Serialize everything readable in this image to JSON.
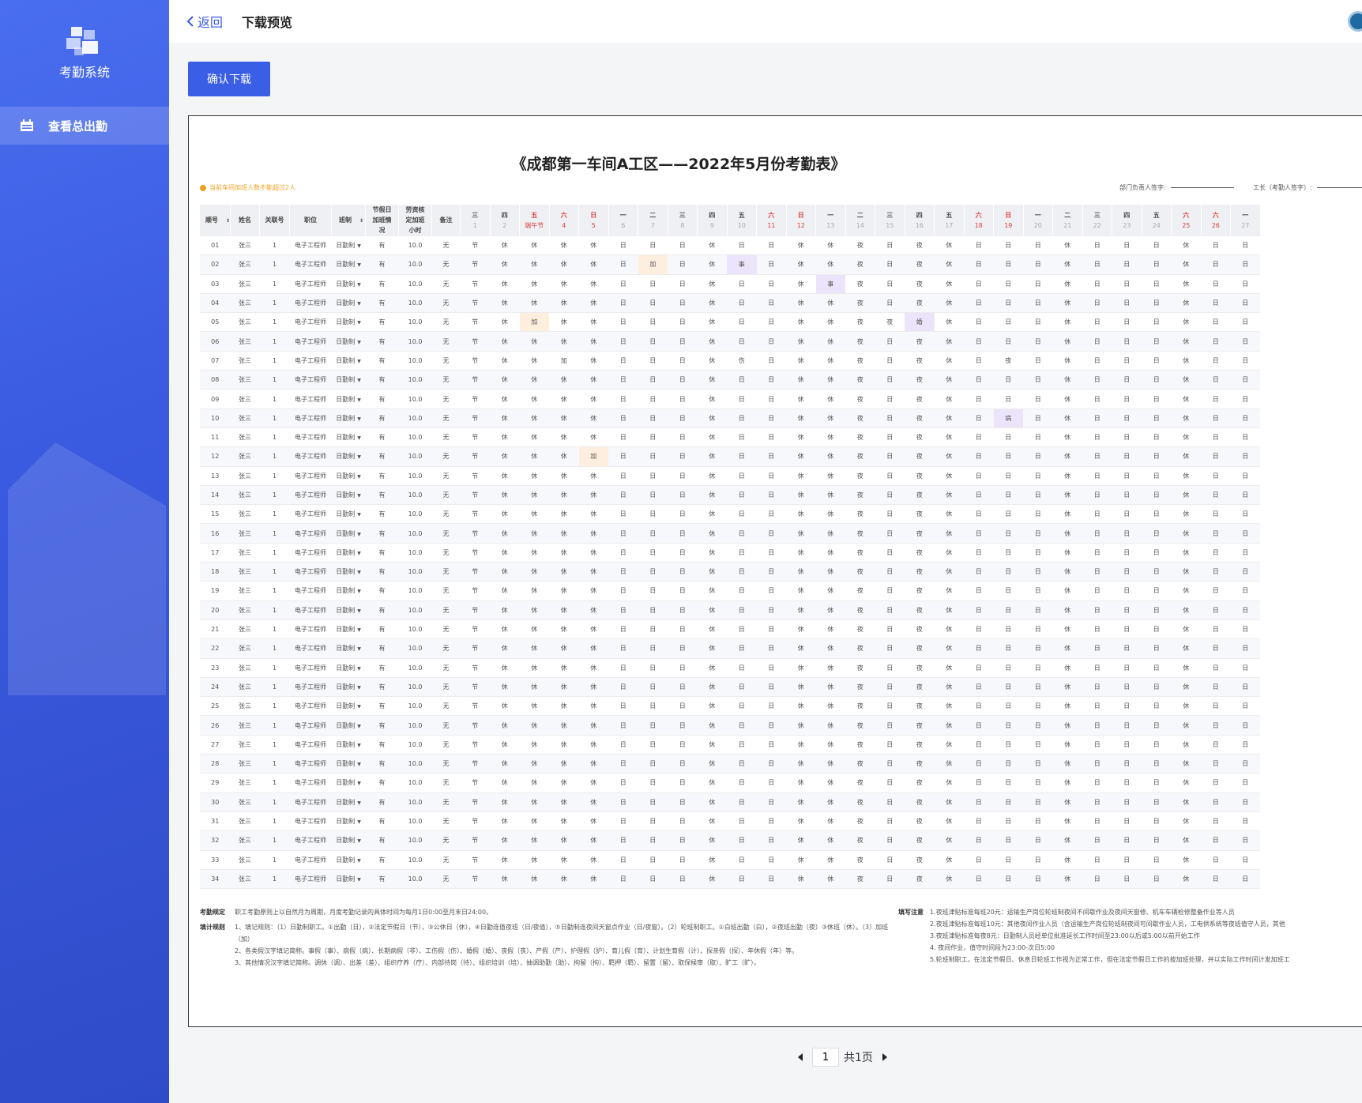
{
  "app": {
    "title": "考勤系统"
  },
  "sidebar": {
    "items": [
      {
        "label": "查看总出勤",
        "icon": "calendar-icon"
      }
    ]
  },
  "header": {
    "back_label": "返回",
    "title": "下载预览"
  },
  "toolbar": {
    "confirm_label": "确认下载"
  },
  "sheet": {
    "title": "《成都第一车间A工区——2022年5月份考勤表》",
    "notice": "当前车间加班人数不能超过2人",
    "sign_dept": "部门负责人签字:",
    "sign_leader": "工长（考勤人签字）:",
    "columns": {
      "seq": "顺号",
      "name": "姓名",
      "link": "关联号",
      "post": "职位",
      "shift": "班制",
      "holiday": "节假日加班情况",
      "ot": "劳资核定加班小时",
      "remark": "备注"
    },
    "days": [
      {
        "w": "三",
        "d": "1"
      },
      {
        "w": "四",
        "d": "2"
      },
      {
        "w": "五",
        "d": "端午节",
        "red": true
      },
      {
        "w": "六",
        "d": "4",
        "red": true
      },
      {
        "w": "日",
        "d": "5",
        "red": true
      },
      {
        "w": "一",
        "d": "6"
      },
      {
        "w": "二",
        "d": "7"
      },
      {
        "w": "三",
        "d": "8"
      },
      {
        "w": "四",
        "d": "9"
      },
      {
        "w": "五",
        "d": "10"
      },
      {
        "w": "六",
        "d": "11",
        "red": true
      },
      {
        "w": "日",
        "d": "12",
        "red": true
      },
      {
        "w": "一",
        "d": "13"
      },
      {
        "w": "二",
        "d": "14"
      },
      {
        "w": "三",
        "d": "15"
      },
      {
        "w": "四",
        "d": "16"
      },
      {
        "w": "五",
        "d": "17"
      },
      {
        "w": "六",
        "d": "18",
        "red": true
      },
      {
        "w": "日",
        "d": "19",
        "red": true
      },
      {
        "w": "一",
        "d": "20"
      },
      {
        "w": "二",
        "d": "21"
      },
      {
        "w": "三",
        "d": "22"
      },
      {
        "w": "四",
        "d": "23"
      },
      {
        "w": "五",
        "d": "24"
      },
      {
        "w": "六",
        "d": "25",
        "red": true
      },
      {
        "w": "六",
        "d": "26",
        "red": true
      },
      {
        "w": "一",
        "d": "27"
      }
    ],
    "row_template": {
      "name": "张三",
      "link": "1",
      "post": "电子工程师",
      "shift": "日勤制",
      "holiday": "有",
      "ot": "10.0",
      "remark": "无",
      "days": [
        "节",
        "休",
        "休",
        "休",
        "休",
        "日",
        "日",
        "日",
        "休",
        "日",
        "日",
        "休",
        "休",
        "夜",
        "日",
        "夜",
        "休",
        "日",
        "日",
        "日",
        "休",
        "日",
        "日",
        "日",
        "休",
        "日",
        "日"
      ]
    },
    "row_count": 34,
    "overrides": [
      {
        "row": 1,
        "col": 6,
        "v": "加",
        "hl": "or"
      },
      {
        "row": 1,
        "col": 9,
        "v": "事",
        "hl": "pu"
      },
      {
        "row": 2,
        "col": 12,
        "v": "事",
        "hl": "pu"
      },
      {
        "row": 4,
        "col": 2,
        "v": "加",
        "hl": "or"
      },
      {
        "row": 4,
        "col": 15,
        "v": "婚",
        "hl": "pu"
      },
      {
        "row": 4,
        "col": 14,
        "v": "夜"
      },
      {
        "row": 6,
        "col": 3,
        "v": "加"
      },
      {
        "row": 6,
        "col": 9,
        "v": "伤"
      },
      {
        "row": 6,
        "col": 18,
        "v": "夜"
      },
      {
        "row": 9,
        "col": 18,
        "v": "病",
        "hl": "pu"
      },
      {
        "row": 11,
        "col": 4,
        "v": "加",
        "hl": "or"
      }
    ],
    "rules_label": "考勤规定",
    "rules_text": "职工考勤原则上以自然月为周期，月度考勤记录的具体时间为每月1日0:00至月末日24:00。",
    "fill_label": "填计规则",
    "fill_lines": [
      "1、填记规则：（1）日勤制职工。①出勤（日），②法定节假日（节），③公休日（休），④日勤连值夜班（日/夜值），⑤日勤制连夜间天窗点作业（日/夜窗）。（2）轮班制职工。①白班出勤（白），②夜班出勤（夜）③休班（休）。（3）加班（加）",
      "2、各类假汉字填记简称。事假（事）、病假（病）、长期病假（非）、工伤假（伤）、婚假（婚）、丧假（丧）、产假（产）、护理假（护）、育儿假（育）、计划生育假（计）、探亲假（探）、年休假（年）等。",
      "3、其他情况汉字填记简称。调休（调）、出差（差）、组织疗养（疗）、内部待岗（待）、组织培训（培）、抽调助勤（助）、拘留（拘）、羁押（羁）、留置（留）、取保候审（取）、旷工（旷）。"
    ],
    "notes_label": "填写注意",
    "notes_lines": [
      "1.夜班津贴标准每班20元：运输生产岗位轮班制夜间不间歇作业及夜间天窗修、机车车辆检修整备作业等人员",
      "2.夜班津贴标准每班10元：其他夜间作业人员（含运输生产岗位轮班制夜间可间歇作业人员，工电供系统等夜班值守人员，其他",
      "3.夜班津贴标准每夜8元：日勤制人员经单位批准延长工作时间至23:00以后或5:00以前开始工作",
      "4. 夜间作业，值守时间段为23:00-次日5:00",
      "5.轮班制职工，在法定节假日、休息日轮班工作视为正常工作，但在法定节假日工作的按加班处理，并以实际工作时间计发加班工"
    ]
  },
  "pager": {
    "current": "1",
    "total_label": "共1页"
  },
  "colors": {
    "primary": "#3b5ee6",
    "holiday_red": "#e23d3d",
    "warning": "#f0a020"
  }
}
